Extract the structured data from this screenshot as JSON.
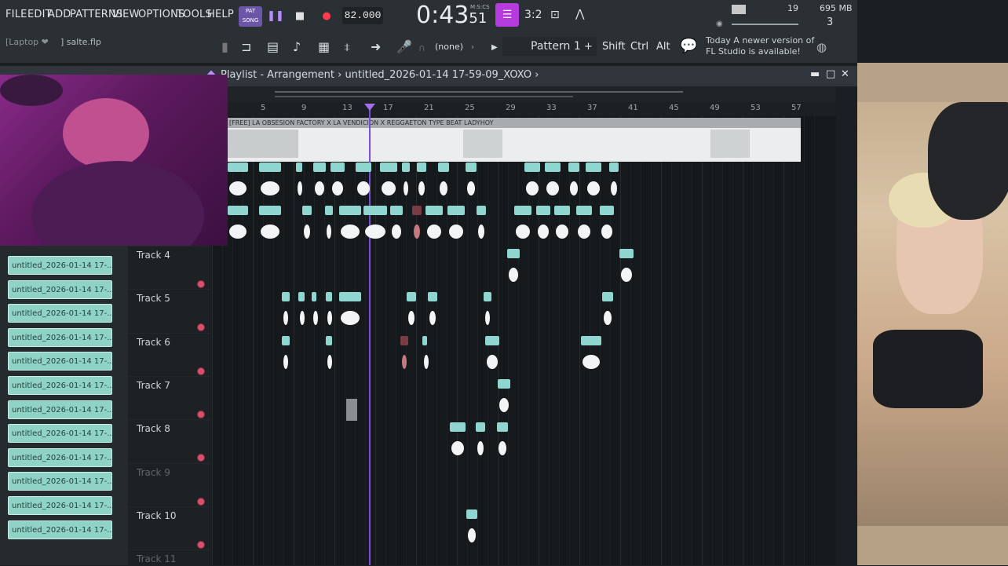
{
  "menu": [
    "FILE",
    "EDIT",
    "ADD",
    "PATTERNS",
    "VIEW",
    "OPTIONS",
    "TOOLS",
    "HELP"
  ],
  "transport": {
    "song_mode_label": "PAT\nSONG",
    "tempo": "82.000",
    "time_main": "0:43",
    "time_sub": "51",
    "time_unit": "M:S:CS"
  },
  "status": {
    "polyphony": "19",
    "memory": "695 MB",
    "voices": "3",
    "news_line1": "Today  A newer version of",
    "news_line2": "FL Studio is available!"
  },
  "toolbar2": {
    "device": "[Laptop ❤",
    "project_file": "] salte.flp",
    "pattern_none": "(none)",
    "pattern_name": "Pattern 1",
    "plus": "+",
    "shift": "Shift",
    "ctrl": "Ctrl",
    "alt": "Alt"
  },
  "playlist": {
    "title": "Playlist - Arrangement",
    "file": "untitled_2026-01-14 17-59-09_XOXO",
    "audio_clip_title": "[FREE] LA OBSESION FACTORY X LA VENDICION X REGGAETON TYPE BEAT LADYHOY",
    "bars": [
      "5",
      "9",
      "13",
      "17",
      "21",
      "25",
      "29",
      "33",
      "37",
      "41",
      "45",
      "49",
      "53",
      "57"
    ],
    "tracks": [
      {
        "name": "Track 4",
        "dim": false
      },
      {
        "name": "Track 5",
        "dim": false
      },
      {
        "name": "Track 6",
        "dim": false
      },
      {
        "name": "Track 7",
        "dim": false
      },
      {
        "name": "Track 8",
        "dim": false
      },
      {
        "name": "Track 9",
        "dim": true
      },
      {
        "name": "Track 10",
        "dim": false
      },
      {
        "name": "Track 11",
        "dim": true
      }
    ]
  },
  "patterns": [
    "untitled_2026-01-14 17-...",
    "untitled_2026-01-14 17-...",
    "untitled_2026-01-14 17-...",
    "untitled_2026-01-14 17-...",
    "untitled_2026-01-14 17-...",
    "untitled_2026-01-14 17-...",
    "untitled_2026-01-14 17-...",
    "untitled_2026-01-14 17-...",
    "untitled_2026-01-14 17-...",
    "untitled_2026-01-14 17-...",
    "untitled_2026-01-14 17-...",
    "untitled_2026-01-14 17-..."
  ],
  "colors": {
    "accent": "#b63bdc",
    "clip": "#8ed6cf",
    "playhead": "#7c4bd8"
  }
}
